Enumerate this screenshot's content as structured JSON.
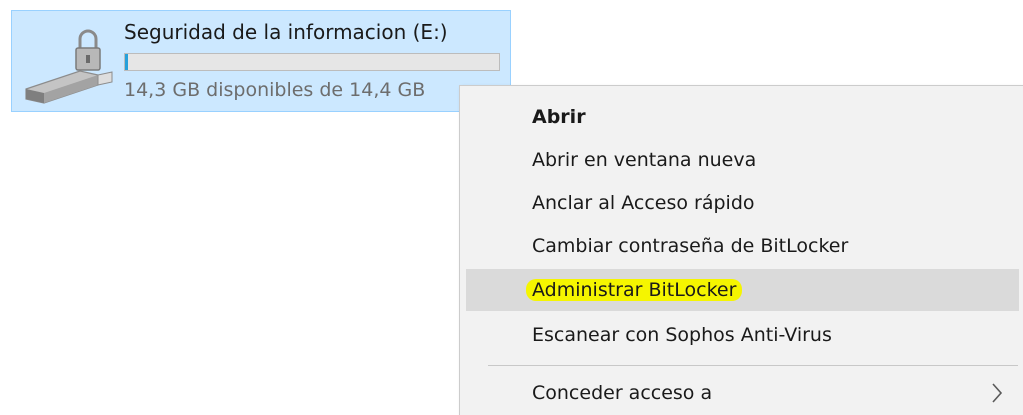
{
  "drive": {
    "title": "Seguridad de la informacion (E:)",
    "free_space": "14,3 GB disponibles de 14,4 GB",
    "used_fraction": 0.007,
    "icon": "locked-usb-drive-icon"
  },
  "context_menu": {
    "items": [
      {
        "label": "Abrir",
        "bold": true
      },
      {
        "label": "Abrir en ventana nueva"
      },
      {
        "label": "Anclar al Acceso rápido"
      },
      {
        "label": "Cambiar contraseña de BitLocker"
      },
      {
        "label": "Administrar BitLocker",
        "hovered": true,
        "highlighted": true
      },
      {
        "label": "Escanear con Sophos Anti-Virus"
      },
      {
        "label": "Conceder acceso a",
        "has_submenu": true
      }
    ]
  },
  "colors": {
    "tile_bg": "#cce8ff",
    "tile_border": "#99d1ff",
    "menu_bg": "#f2f2f2",
    "hover_bg": "#dadada",
    "highlight": "#f5f500"
  }
}
